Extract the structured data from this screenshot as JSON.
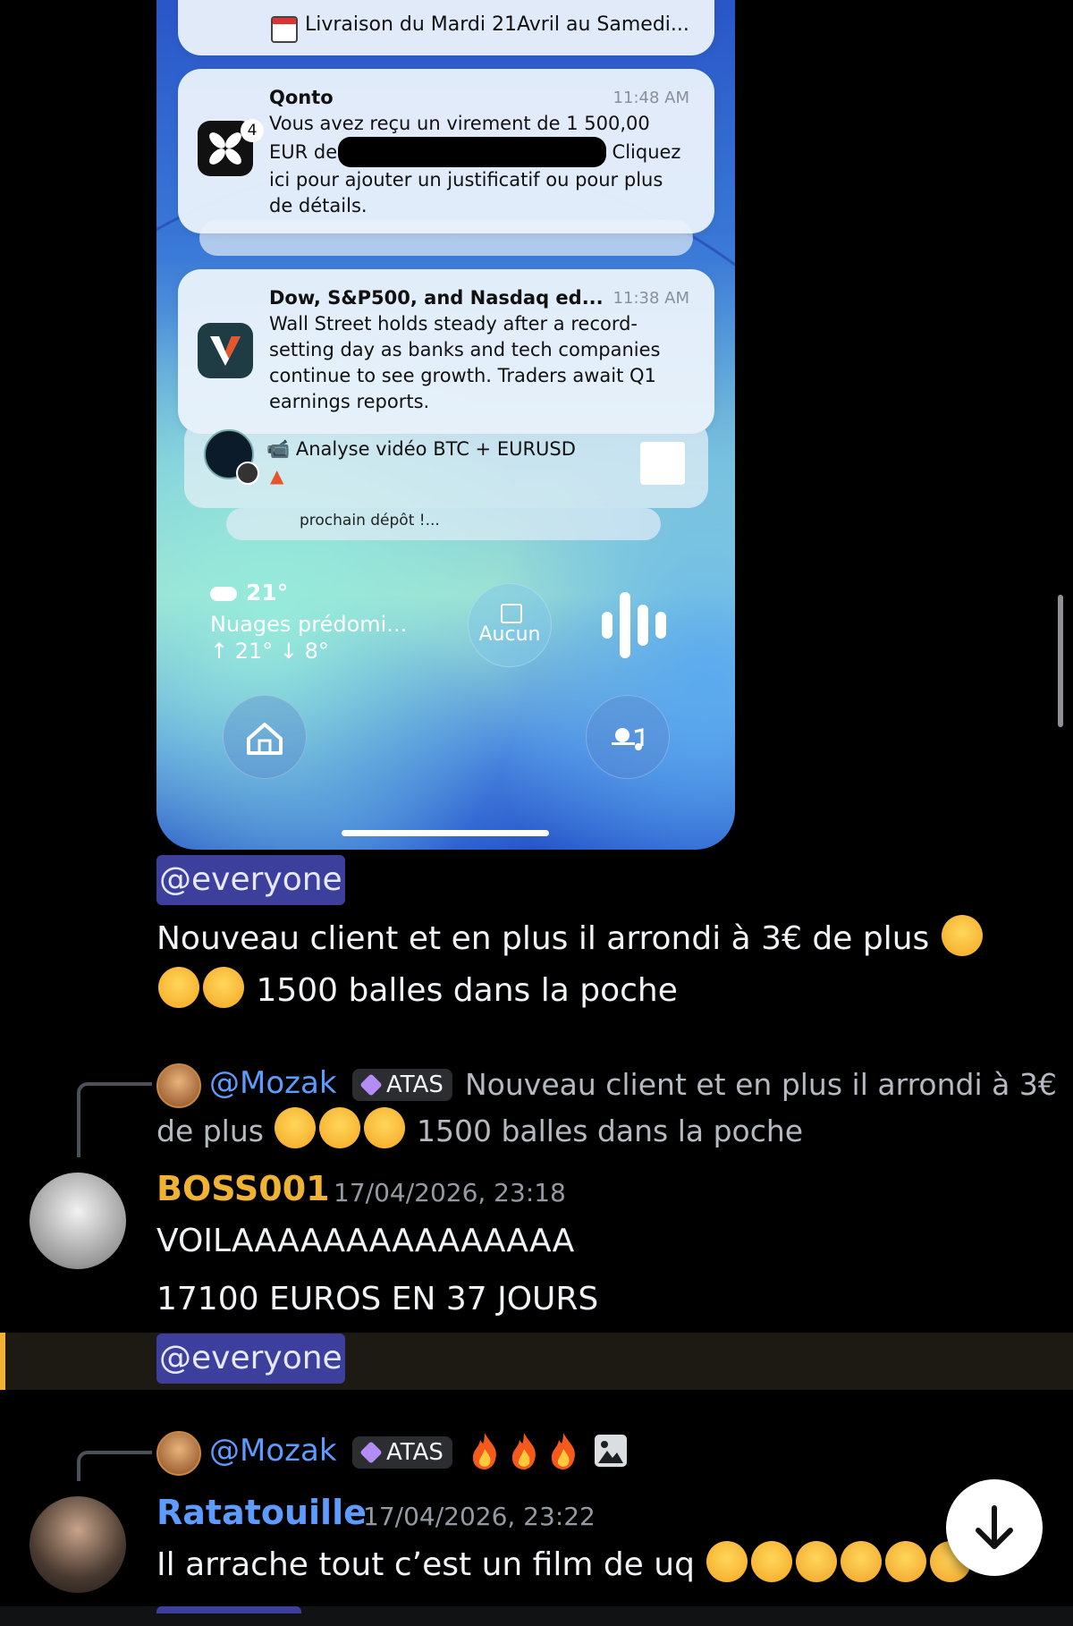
{
  "phone": {
    "top_notification_text": "Livraison du Mardi  21Avril au Samedi...",
    "notifications": [
      {
        "app": "Qonto",
        "badge": "4",
        "time": "11:48 AM",
        "body": "Vous avez reçu un virement de 1 500,00 EUR de",
        "body_cont": "Cliquez ici pour ajouter un justificatif ou pour plus de détails."
      },
      {
        "app": "Dow, S&P500, and Nasdaq ed...",
        "time": "11:38 AM",
        "body": "Wall Street holds steady after a record-setting day as banks and tech companies continue to see growth. Traders await Q1 earnings reports."
      }
    ],
    "stacked_notification": "📹 Analyse vidéo BTC + EURUSD",
    "stacked_notification_2": "prochain dépôt !...",
    "weather": {
      "temp": "21°",
      "condition": "Nuages prédomi...",
      "range": "↑ 21° ↓ 8°"
    },
    "calendar_widget": "Aucun"
  },
  "messages": {
    "first": {
      "mention": "@everyone",
      "text_line1": "Nouveau client et en plus il arrondi à 3€ de plus",
      "text_line2": "1500 balles dans la poche"
    },
    "second": {
      "reply": {
        "name": "@Mozak",
        "role": "ATAS",
        "preview_line1": "Nouveau client et en plus il arrondi à 3€",
        "preview_line2": "de plus",
        "preview_line2_end": "1500 balles dans la poche"
      },
      "author": "BOSS001",
      "author_color": "#f0b232",
      "timestamp": "17/04/2026, 23:18",
      "line1": "VOILAAAAAAAAAAAAAAA",
      "line2": "17100 EUROS EN 37 JOURS",
      "mention": "@everyone"
    },
    "third": {
      "reply": {
        "name": "@Mozak",
        "role": "ATAS"
      },
      "author": "Ratatouille",
      "author_color": "#5d9bff",
      "timestamp": "17/04/2026, 23:22",
      "text": "Il arrache tout c’est un film de uq"
    }
  },
  "icons": [
    "calendar-icon",
    "qonto-icon",
    "vanguard-icon",
    "telegram-icon",
    "cloud-icon",
    "mic-icon",
    "home-icon",
    "sun-music-icon",
    "fire-icon",
    "image-icon",
    "arrow-down-icon"
  ]
}
